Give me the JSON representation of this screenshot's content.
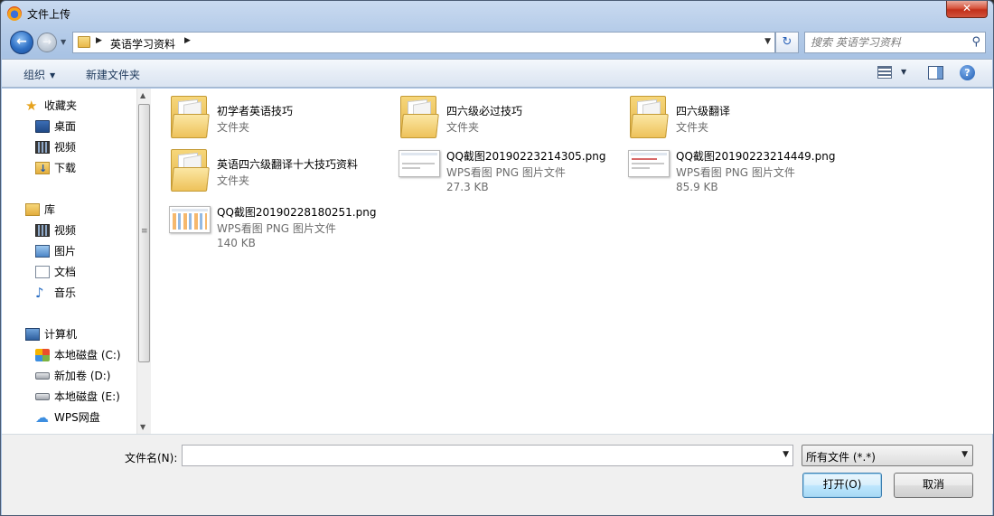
{
  "window": {
    "title": "文件上传",
    "close_label": "✕"
  },
  "nav": {
    "back_glyph": "←",
    "forward_glyph": "→",
    "address": {
      "path": "英语学习资料"
    },
    "refresh_glyph": "↻",
    "search": {
      "placeholder": "搜索 英语学习资料"
    }
  },
  "toolbar": {
    "organize_label": "组织",
    "new_folder_label": "新建文件夹",
    "help_label": "?"
  },
  "sidebar": {
    "favorites": {
      "label": "收藏夹",
      "icon": "star-icon",
      "items": [
        {
          "label": "桌面",
          "icon": "desktop-icon"
        },
        {
          "label": "视频",
          "icon": "video-icon"
        },
        {
          "label": "下载",
          "icon": "downloads-icon"
        }
      ]
    },
    "libraries": {
      "label": "库",
      "icon": "library-icon",
      "items": [
        {
          "label": "视频",
          "icon": "video-icon"
        },
        {
          "label": "图片",
          "icon": "pictures-icon"
        },
        {
          "label": "文档",
          "icon": "documents-icon"
        },
        {
          "label": "音乐",
          "icon": "music-icon"
        }
      ]
    },
    "computer": {
      "label": "计算机",
      "icon": "computer-icon",
      "items": [
        {
          "label": "本地磁盘 (C:)",
          "icon": "system-drive-icon"
        },
        {
          "label": "新加卷 (D:)",
          "icon": "drive-icon"
        },
        {
          "label": "本地磁盘 (E:)",
          "icon": "drive-icon"
        },
        {
          "label": "WPS网盘",
          "icon": "cloud-icon"
        }
      ]
    }
  },
  "files": [
    {
      "name": "初学者英语技巧",
      "type": "文件夹",
      "kind": "folder"
    },
    {
      "name": "四六级必过技巧",
      "type": "文件夹",
      "kind": "folder"
    },
    {
      "name": "四六级翻译",
      "type": "文件夹",
      "kind": "folder"
    },
    {
      "name": "英语四六级翻译十大技巧资料",
      "type": "文件夹",
      "kind": "folder"
    },
    {
      "name": "QQ截图20190223214305.png",
      "type": "WPS看图 PNG 图片文件",
      "size": "27.3 KB",
      "kind": "image"
    },
    {
      "name": "QQ截图20190223214449.png",
      "type": "WPS看图 PNG 图片文件",
      "size": "85.9 KB",
      "kind": "image"
    },
    {
      "name": "QQ截图20190228180251.png",
      "type": "WPS看图 PNG 图片文件",
      "size": "140 KB",
      "kind": "image"
    }
  ],
  "bottom": {
    "filename_label": "文件名(N):",
    "filename_value": "",
    "filetype_value": "所有文件 (*.*)",
    "open_label": "打开(O)",
    "cancel_label": "取消"
  }
}
